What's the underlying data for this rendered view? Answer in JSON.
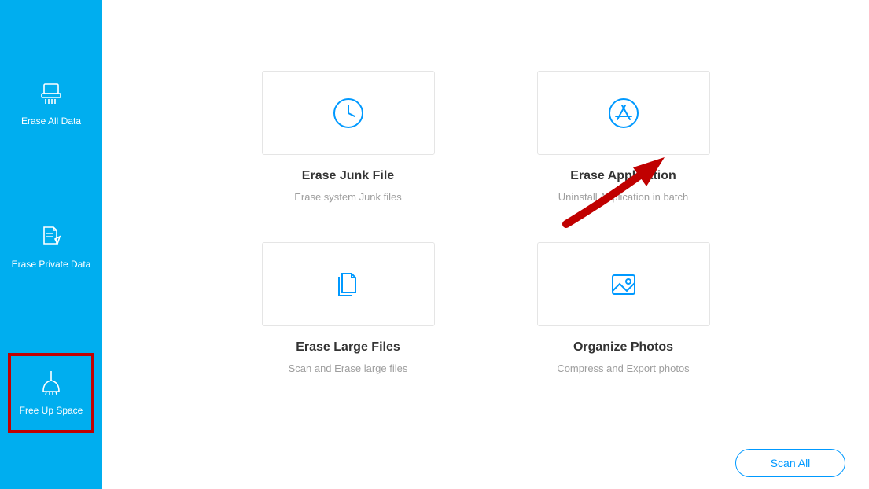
{
  "sidebar": {
    "items": [
      {
        "label": "Erase All Data"
      },
      {
        "label": "Erase Private Data"
      },
      {
        "label": "Free Up Space"
      }
    ],
    "selected_index": 2
  },
  "main": {
    "cards": [
      {
        "title": "Erase Junk File",
        "desc": "Erase system Junk files"
      },
      {
        "title": "Erase Application",
        "desc": "Uninstall Application in batch"
      },
      {
        "title": "Erase Large Files",
        "desc": "Scan and Erase large files"
      },
      {
        "title": "Organize Photos",
        "desc": "Compress and Export photos"
      }
    ]
  },
  "footer": {
    "scan_all_label": "Scan All"
  },
  "colors": {
    "accent": "#00aeef",
    "icon_blue": "#0099ff",
    "annotation_red": "#c00000"
  }
}
